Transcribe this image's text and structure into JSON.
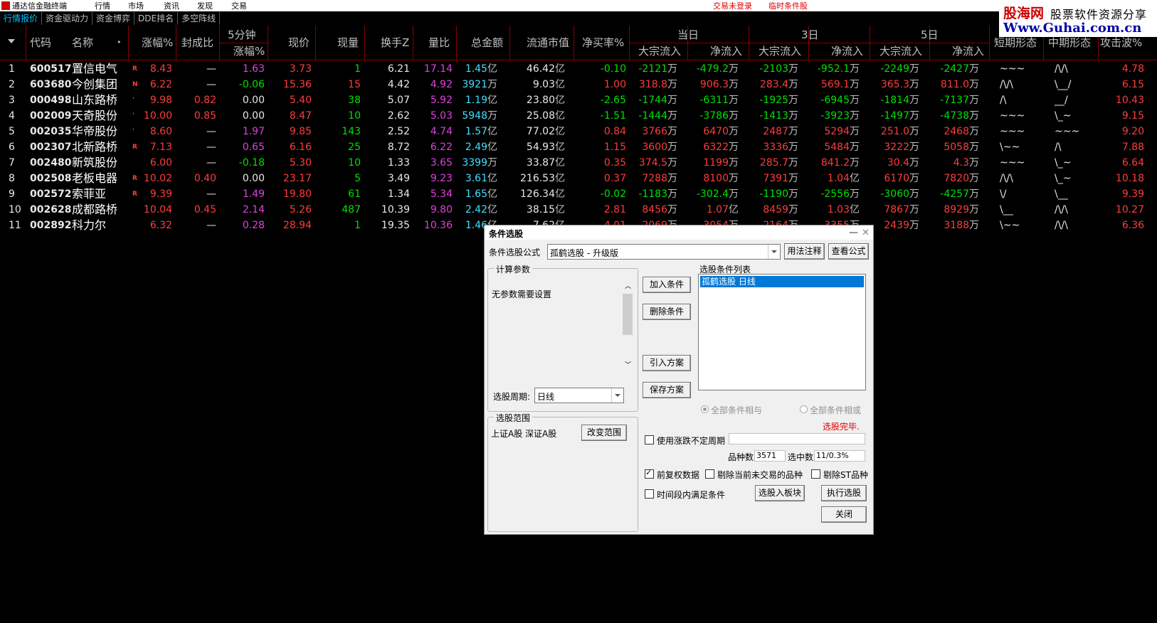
{
  "menubar": {
    "app_title": "通达信金融终端",
    "items": [
      "行情",
      "市场",
      "资讯",
      "发现",
      "交易"
    ],
    "login_warning": "交易未登录",
    "temp_label": "临时条件股"
  },
  "watermark": {
    "line1a": "股海网",
    "line1b": "股票软件资源分享",
    "line2": "Www.Guhai.com.cn"
  },
  "tabs": [
    "行情报价",
    "资金驱动力",
    "资金博弈",
    "DDE排名",
    "多空阵线"
  ],
  "header": {
    "code": "代码",
    "name": "名称",
    "pct": "涨幅%",
    "seal": "封成比",
    "min5": "5分钟",
    "min5_sub": "涨幅%",
    "price": "现价",
    "vol": "现量",
    "turnover": "换手Z",
    "vol_ratio": "量比",
    "amount": "总金额",
    "mcap": "流通市值",
    "net_buy": "净买率%",
    "day": "当日",
    "d3": "3日",
    "d5": "5日",
    "big_in": "大宗流入",
    "net_in": "净流入",
    "short": "短期形态",
    "mid": "中期形态",
    "wave": "攻击波%"
  },
  "colors": {
    "up": "#ff3c3c",
    "down": "#00e000",
    "flat": "#e8e8e8",
    "grid": "#800000",
    "select": "#0078d7"
  },
  "rows": [
    {
      "n": "1",
      "code": "600517",
      "name": "置信电气",
      "flag": "R",
      "pct": "8.43",
      "seal": "—",
      "m5": "1.63",
      "price": "3.73",
      "vol": "1",
      "turn": "6.21",
      "vr": "17.14",
      "amt": "1.45",
      "amt_u": "亿",
      "mcap": "46.42",
      "mcap_u": "亿",
      "nb": "-0.10",
      "b1": "-2121",
      "b1u": "万",
      "n1": "-479.2",
      "n1u": "万",
      "b3": "-2103",
      "b3u": "万",
      "n3": "-952.1",
      "n3u": "万",
      "b5": "-2249",
      "b5u": "万",
      "n5": "-2427",
      "n5u": "万",
      "sh": "~~~",
      "md": "/\\/\\",
      "wave": "4.78"
    },
    {
      "n": "2",
      "code": "603680",
      "name": "今创集团",
      "flag": "N",
      "pct": "6.22",
      "seal": "—",
      "m5": "-0.06",
      "price": "15.36",
      "vol": "15",
      "turn": "4.42",
      "vr": "4.92",
      "amt": "3921",
      "amt_u": "万",
      "mcap": "9.03",
      "mcap_u": "亿",
      "nb": "1.00",
      "b1": "318.8",
      "b1u": "万",
      "n1": "906.3",
      "n1u": "万",
      "b3": "283.4",
      "b3u": "万",
      "n3": "569.1",
      "n3u": "万",
      "b5": "365.3",
      "b5u": "万",
      "n5": "811.0",
      "n5u": "万",
      "sh": "/\\/\\",
      "md": "\\__/",
      "wave": "6.15"
    },
    {
      "n": "3",
      "code": "000498",
      "name": "山东路桥",
      "flag": "'",
      "pct": "9.98",
      "seal": "0.82",
      "m5": "0.00",
      "price": "5.40",
      "vol": "38",
      "turn": "5.07",
      "vr": "5.92",
      "amt": "1.19",
      "amt_u": "亿",
      "mcap": "23.80",
      "mcap_u": "亿",
      "nb": "-2.65",
      "b1": "-1744",
      "b1u": "万",
      "n1": "-6311",
      "n1u": "万",
      "b3": "-1925",
      "b3u": "万",
      "n3": "-6945",
      "n3u": "万",
      "b5": "-1814",
      "b5u": "万",
      "n5": "-7137",
      "n5u": "万",
      "sh": "/\\",
      "md": "__/",
      "wave": "10.43"
    },
    {
      "n": "4",
      "code": "002009",
      "name": "天奇股份",
      "flag": "'",
      "pct": "10.00",
      "seal": "0.85",
      "m5": "0.00",
      "price": "8.47",
      "vol": "10",
      "turn": "2.62",
      "vr": "5.03",
      "amt": "5948",
      "amt_u": "万",
      "mcap": "25.08",
      "mcap_u": "亿",
      "nb": "-1.51",
      "b1": "-1444",
      "b1u": "万",
      "n1": "-3786",
      "n1u": "万",
      "b3": "-1413",
      "b3u": "万",
      "n3": "-3923",
      "n3u": "万",
      "b5": "-1497",
      "b5u": "万",
      "n5": "-4738",
      "n5u": "万",
      "sh": "~~~",
      "md": "\\_~",
      "wave": "9.15"
    },
    {
      "n": "5",
      "code": "002035",
      "name": "华帝股份",
      "flag": "'",
      "pct": "8.60",
      "seal": "—",
      "m5": "1.97",
      "price": "9.85",
      "vol": "143",
      "turn": "2.52",
      "vr": "4.74",
      "amt": "1.57",
      "amt_u": "亿",
      "mcap": "77.02",
      "mcap_u": "亿",
      "nb": "0.84",
      "b1": "3766",
      "b1u": "万",
      "n1": "6470",
      "n1u": "万",
      "b3": "2487",
      "b3u": "万",
      "n3": "5294",
      "n3u": "万",
      "b5": "251.0",
      "b5u": "万",
      "n5": "2468",
      "n5u": "万",
      "sh": "~~~",
      "md": "~~~",
      "wave": "9.20"
    },
    {
      "n": "6",
      "code": "002307",
      "name": "北新路桥",
      "flag": "R",
      "pct": "7.13",
      "seal": "—",
      "m5": "0.65",
      "price": "6.16",
      "vol": "25",
      "turn": "8.72",
      "vr": "6.22",
      "amt": "2.49",
      "amt_u": "亿",
      "mcap": "54.93",
      "mcap_u": "亿",
      "nb": "1.15",
      "b1": "3600",
      "b1u": "万",
      "n1": "6322",
      "n1u": "万",
      "b3": "3336",
      "b3u": "万",
      "n3": "5484",
      "n3u": "万",
      "b5": "3222",
      "b5u": "万",
      "n5": "5058",
      "n5u": "万",
      "sh": "\\~~",
      "md": "/\\",
      "wave": "7.88"
    },
    {
      "n": "7",
      "code": "002480",
      "name": "新筑股份",
      "flag": "",
      "pct": "6.00",
      "seal": "—",
      "m5": "-0.18",
      "price": "5.30",
      "vol": "10",
      "turn": "1.33",
      "vr": "3.65",
      "amt": "3399",
      "amt_u": "万",
      "mcap": "33.87",
      "mcap_u": "亿",
      "nb": "0.35",
      "b1": "374.5",
      "b1u": "万",
      "n1": "1199",
      "n1u": "万",
      "b3": "285.7",
      "b3u": "万",
      "n3": "841.2",
      "n3u": "万",
      "b5": "30.4",
      "b5u": "万",
      "n5": "4.3",
      "n5u": "万",
      "sh": "~~~",
      "md": "\\_~",
      "wave": "6.64"
    },
    {
      "n": "8",
      "code": "002508",
      "name": "老板电器",
      "flag": "R",
      "pct": "10.02",
      "seal": "0.40",
      "m5": "0.00",
      "price": "23.17",
      "vol": "5",
      "turn": "3.49",
      "vr": "9.23",
      "amt": "3.61",
      "amt_u": "亿",
      "mcap": "216.53",
      "mcap_u": "亿",
      "nb": "0.37",
      "b1": "7288",
      "b1u": "万",
      "n1": "8100",
      "n1u": "万",
      "b3": "7391",
      "b3u": "万",
      "n3": "1.04",
      "n3u": "亿",
      "b5": "6170",
      "b5u": "万",
      "n5": "7820",
      "n5u": "万",
      "sh": "/\\/\\",
      "md": "\\_~",
      "wave": "10.18"
    },
    {
      "n": "9",
      "code": "002572",
      "name": "索菲亚",
      "flag": "R",
      "pct": "9.39",
      "seal": "—",
      "m5": "1.49",
      "price": "19.80",
      "vol": "61",
      "turn": "1.34",
      "vr": "5.34",
      "amt": "1.65",
      "amt_u": "亿",
      "mcap": "126.34",
      "mcap_u": "亿",
      "nb": "-0.02",
      "b1": "-1183",
      "b1u": "万",
      "n1": "-302.4",
      "n1u": "万",
      "b3": "-1190",
      "b3u": "万",
      "n3": "-2556",
      "n3u": "万",
      "b5": "-3060",
      "b5u": "万",
      "n5": "-4257",
      "n5u": "万",
      "sh": "\\/",
      "md": "\\__",
      "wave": "9.39"
    },
    {
      "n": "10",
      "code": "002628",
      "name": "成都路桥",
      "flag": "",
      "pct": "10.04",
      "seal": "0.45",
      "m5": "2.14",
      "price": "5.26",
      "vol": "487",
      "turn": "10.39",
      "vr": "9.80",
      "amt": "2.42",
      "amt_u": "亿",
      "mcap": "38.15",
      "mcap_u": "亿",
      "nb": "2.81",
      "b1": "8456",
      "b1u": "万",
      "n1": "1.07",
      "n1u": "亿",
      "b3": "8459",
      "b3u": "万",
      "n3": "1.03",
      "n3u": "亿",
      "b5": "7867",
      "b5u": "万",
      "n5": "8929",
      "n5u": "万",
      "sh": "\\__",
      "md": "/\\/\\",
      "wave": "10.27"
    },
    {
      "n": "11",
      "code": "002892",
      "name": "科力尔",
      "flag": "",
      "pct": "6.32",
      "seal": "—",
      "m5": "0.28",
      "price": "28.94",
      "vol": "1",
      "turn": "19.35",
      "vr": "10.36",
      "amt": "1.46",
      "amt_u": "亿",
      "mcap": "7.62",
      "mcap_u": "亿",
      "nb": "4.01",
      "b1": "2069",
      "b1u": "万",
      "n1": "3054",
      "n1u": "万",
      "b3": "2164",
      "b3u": "万",
      "n3": "3355",
      "n3u": "万",
      "b5": "2439",
      "b5u": "万",
      "n5": "3188",
      "n5u": "万",
      "sh": "\\~~",
      "md": "/\\/\\",
      "wave": "6.36"
    }
  ],
  "dialog": {
    "title": "条件选股",
    "formula_label": "条件选股公式",
    "formula_value": "孤鹤选股    - 升级版",
    "usage_btn": "用法注释",
    "view_btn": "查看公式",
    "calc_group": "计算参数",
    "no_params": "无参数需要设置",
    "period_label": "选股周期:",
    "period_value": "日线",
    "add_btn": "加入条件",
    "del_btn": "删除条件",
    "import_btn": "引入方案",
    "save_btn": "保存方案",
    "cond_list_label": "选股条件列表",
    "cond_item": "孤鹤选股  日线",
    "all_and": "全部条件相与",
    "all_or": "全部条件相或",
    "scope_group": "选股范围",
    "scope_text": "上证A股 深证A股",
    "change_scope_btn": "改变范围",
    "status": "选股完毕.",
    "use_period": "使用涨跌不定周期",
    "count_label": "品种数",
    "count_value": "3571",
    "selected_label": "选中数",
    "selected_value": "11/0.3%",
    "prev_adj": "前复权数据",
    "exclude_untraded": "剔除当前未交易的品种",
    "exclude_st": "剔除ST品种",
    "time_range": "时间段内满足条件",
    "to_block_btn": "选股入板块",
    "run_btn": "执行选股",
    "close_btn": "关闭"
  }
}
